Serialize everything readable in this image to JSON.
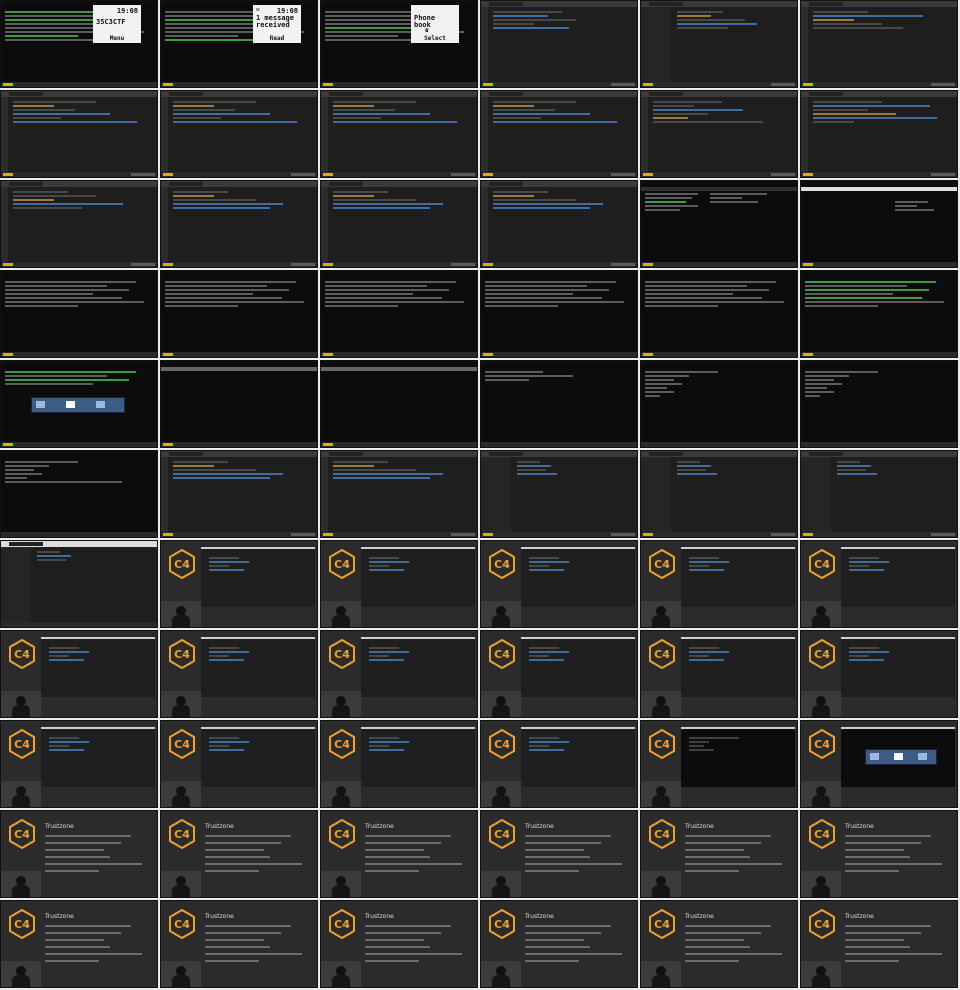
{
  "phones": [
    {
      "time": "19:08",
      "message": "35C3CTF",
      "softkey": "Menu"
    },
    {
      "time": "19:08",
      "message": "1 message received",
      "softkey": "Read"
    },
    {
      "time": "",
      "message": "Phone book",
      "softkey": "Select"
    }
  ],
  "slide": {
    "title": "Trustzone",
    "logo": "C4"
  },
  "colors": {
    "editor_bg": "#1e1e1e",
    "terminal_bg": "#0c0c0c",
    "slide_bg": "#2b2b2b",
    "logo_orange": "#f0a12a",
    "status_yellow": "#d7b200"
  },
  "icons": {
    "hex_logo": "c4-hexagon-logo-icon",
    "envelope": "envelope-icon",
    "phonebook": "phonebook-icon"
  }
}
